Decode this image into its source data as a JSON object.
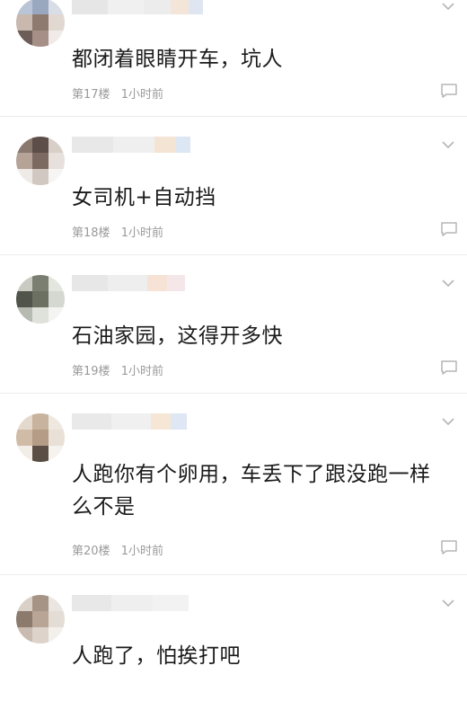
{
  "comments": [
    {
      "text": "都闭着眼睛开车，坑人",
      "floor": "第17楼",
      "time": "1小时前",
      "show_meta": true
    },
    {
      "text": "女司机+自动挡",
      "floor": "第18楼",
      "time": "1小时前",
      "show_meta": true
    },
    {
      "text": "石油家园，这得开多快",
      "floor": "第19楼",
      "time": "1小时前",
      "show_meta": true
    },
    {
      "text": "人跑你有个卵用，车丢下了跟没跑一样么不是",
      "floor": "第20楼",
      "time": "1小时前",
      "show_meta": true
    },
    {
      "text": "人跑了，怕挨打吧",
      "floor": "",
      "time": "",
      "show_meta": false
    }
  ],
  "icons": {
    "expand": "chevron-down-icon",
    "reply": "comment-bubble-icon"
  },
  "colors": {
    "text": "#1a1a1a",
    "meta": "#9a9a9a",
    "divider": "#ececec",
    "icon": "#b5b5b5"
  }
}
